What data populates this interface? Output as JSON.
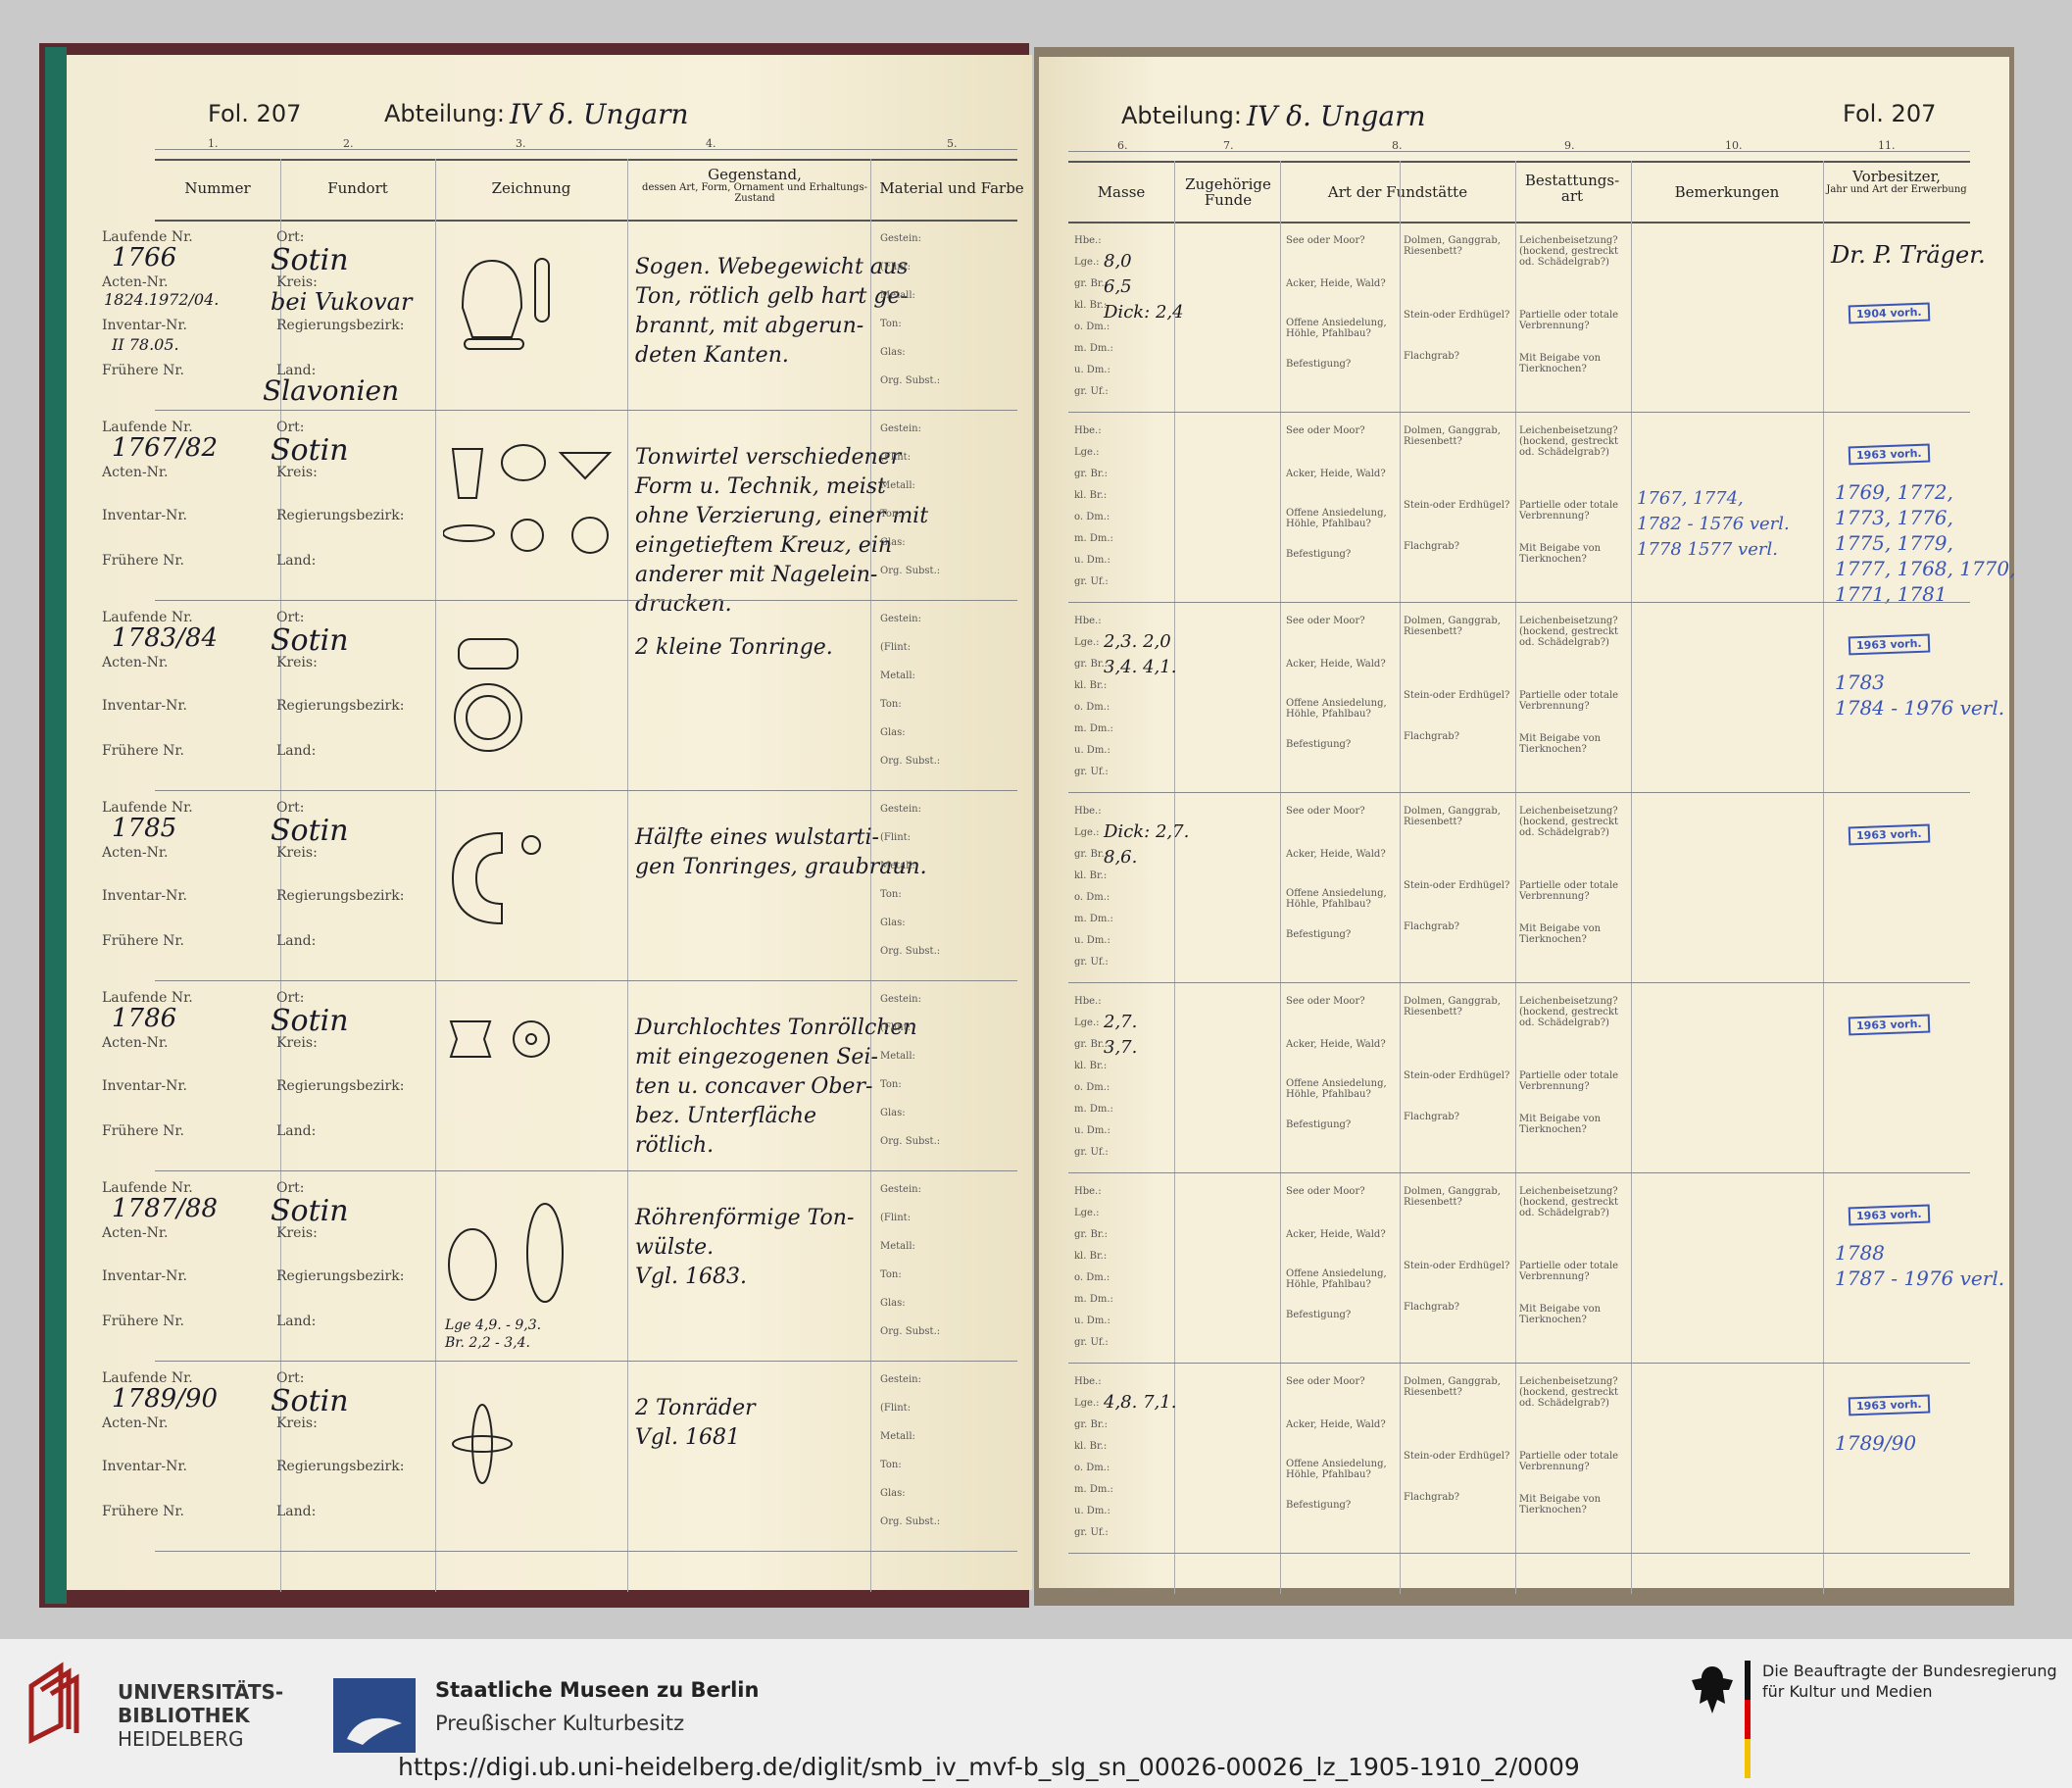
{
  "left_header": {
    "fol": "Fol. 207",
    "abteilung": "Abteilung:",
    "abt_value": "IV δ. Ungarn"
  },
  "right_header": {
    "fol": "Fol. 207",
    "abteilung": "Abteilung:",
    "abt_value": "IV δ. Ungarn"
  },
  "col_numbers_left": [
    "1.",
    "2.",
    "3.",
    "4.",
    "5."
  ],
  "col_numbers_right": [
    "6.",
    "7.",
    "8.",
    "9.",
    "10.",
    "11."
  ],
  "columns": {
    "nummer": "Nummer",
    "fundort": "Fundort",
    "zeichnung": "Zeichnung",
    "gegenstand": "Gegenstand,",
    "gegenstand_sub": "dessen Art, Form, Ornament und Erhaltungs-Zustand",
    "material": "Material und Farbe",
    "masse": "Masse",
    "zugehoerige": "Zugehörige Funde",
    "art": "Art der Fundstätte",
    "bestattung": "Bestattungs- art",
    "bemerkungen": "Bemerkungen",
    "vorbesitzer": "Vorbesitzer,",
    "vorbesitzer_sub": "Jahr und Art der Erwerbung"
  },
  "row_labels": {
    "laufende": "Laufende Nr.",
    "acten": "Acten-Nr.",
    "inventar": "Inventar-Nr.",
    "fruehere": "Frühere Nr.",
    "ort": "Ort:",
    "kreis": "Kreis:",
    "regbez": "Regierungsbezirk:",
    "land": "Land:",
    "gestein": "Gestein:",
    "flint": "(Flint:",
    "metall": "Metall:",
    "ton": "Ton:",
    "glas": "Glas:",
    "org": "Org. Subst.:",
    "hbe": "Hbe.:",
    "lge": "Lge.:",
    "grbr": "gr. Br.:",
    "klbr": "kl. Br.:",
    "odm": "o. Dm.:",
    "mdm": "m. Dm.:",
    "udm": "u. Dm.:",
    "gruf": "gr. Uf.:",
    "see": "See oder Moor?",
    "acker": "Acker, Heide, Wald?",
    "offene": "Offene Ansiedelung, Höhle, Pfahlbau?",
    "befestigung": "Befestigung?",
    "dolmen": "Dolmen, Ganggrab, Riesenbett?",
    "stein": "Stein-oder Erdhügel?",
    "flachgrab": "Flachgrab?",
    "leichen": "Leichenbeisetzung? (hockend, gestreckt od. Schädelgrab?)",
    "partielle": "Partielle oder totale Verbrennung?",
    "beigabe": "Mit Beigabe von Tierknochen?"
  },
  "entries": [
    {
      "nummer": "1766",
      "acten": "1824.1972/04.",
      "inventar": "II 78.05.",
      "ort": "Sotin",
      "kreis": "bei Vukovar",
      "land": "Slavonien",
      "gegenstand": [
        "Sogen. Webegewicht aus",
        "Ton, rötlich gelb hart ge-",
        "brannt, mit abgerun-",
        "deten Kanten."
      ],
      "masse": [
        "8,0",
        "6,5",
        "Dick: 2,4"
      ],
      "vorbesitzer": "Dr. P. Träger.",
      "stamp": "1904 vorh."
    },
    {
      "nummer": "1767/82",
      "ort": "Sotin",
      "gegenstand": [
        "Tonwirtel verschiedener",
        "Form u. Technik, meist",
        "ohne Verzierung, einer mit",
        "eingetieftem Kreuz, ein",
        "anderer mit Nagelein-",
        "drucken."
      ],
      "bemerkungen": [
        "1767, 1774,",
        "1782 - 1576 verl.",
        "1778   1577 verl."
      ],
      "vorbesitzer_notes": [
        "1769, 1772,",
        "1773, 1776,",
        "1775, 1779,",
        "1777, 1768, 1770,",
        "1771, 1781"
      ],
      "stamp": "1963 vorh."
    },
    {
      "nummer": "1783/84",
      "ort": "Sotin",
      "gegenstand": [
        "2 kleine Tonringe."
      ],
      "masse": [
        "2,3. 2,0",
        "3,4. 4,1."
      ],
      "vorbesitzer_notes": [
        "1783",
        "1784 - 1976 verl."
      ],
      "stamp": "1963 vorh."
    },
    {
      "nummer": "1785",
      "ort": "Sotin",
      "gegenstand": [
        "Hälfte eines wulstarti-",
        "gen Tonringes, graubraun."
      ],
      "masse": [
        "Dick: 2,7.",
        "8,6."
      ],
      "stamp": "1963 vorh."
    },
    {
      "nummer": "1786",
      "ort": "Sotin",
      "gegenstand": [
        "Durchlochtes Tonröllchen",
        "mit eingezogenen Sei-",
        "ten u. concaver Ober-",
        "bez. Unterfläche",
        "rötlich."
      ],
      "masse": [
        "2,7.",
        "3,7."
      ],
      "stamp": "1963 vorh."
    },
    {
      "nummer": "1787/88",
      "ort": "Sotin",
      "gegenstand": [
        "Röhrenförmige Ton-",
        "wülste.",
        "Vgl. 1683."
      ],
      "zeichnung_text": [
        "Lge 4,9. - 9,3.",
        "Br. 2,2 - 3,4."
      ],
      "vorbesitzer_notes": [
        "1788",
        "1787 - 1976 verl."
      ],
      "stamp": "1963 vorh."
    },
    {
      "nummer": "1789/90",
      "ort": "Sotin",
      "gegenstand": [
        "2 Tonräder",
        "Vgl. 1681"
      ],
      "masse": [
        "4,8. 7,1."
      ],
      "vorbesitzer_notes": [
        "1789/90"
      ],
      "stamp": "1963 vorh."
    }
  ],
  "footer": {
    "ub_line1": "UNIVERSITÄTS-",
    "ub_line2": "BIBLIOTHEK",
    "ub_line3": "HEIDELBERG",
    "smb_line1": "Staatliche Museen zu Berlin",
    "smb_line2": "Preußischer Kulturbesitz",
    "bkm_line1": "Die Beauftragte der Bundesregierung",
    "bkm_line2": "für Kultur und Medien",
    "url": "https://digi.ub.uni-heidelberg.de/diglit/smb_iv_mvf-b_slg_sn_00026-00026_lz_1905-1910_2/0009"
  },
  "colors": {
    "page": "#f6efd9",
    "ink": "#1c1c28",
    "stamp_blue": "#3a55b8",
    "ub_red": "#a3201e",
    "smb_blue": "#2a4a8a"
  }
}
